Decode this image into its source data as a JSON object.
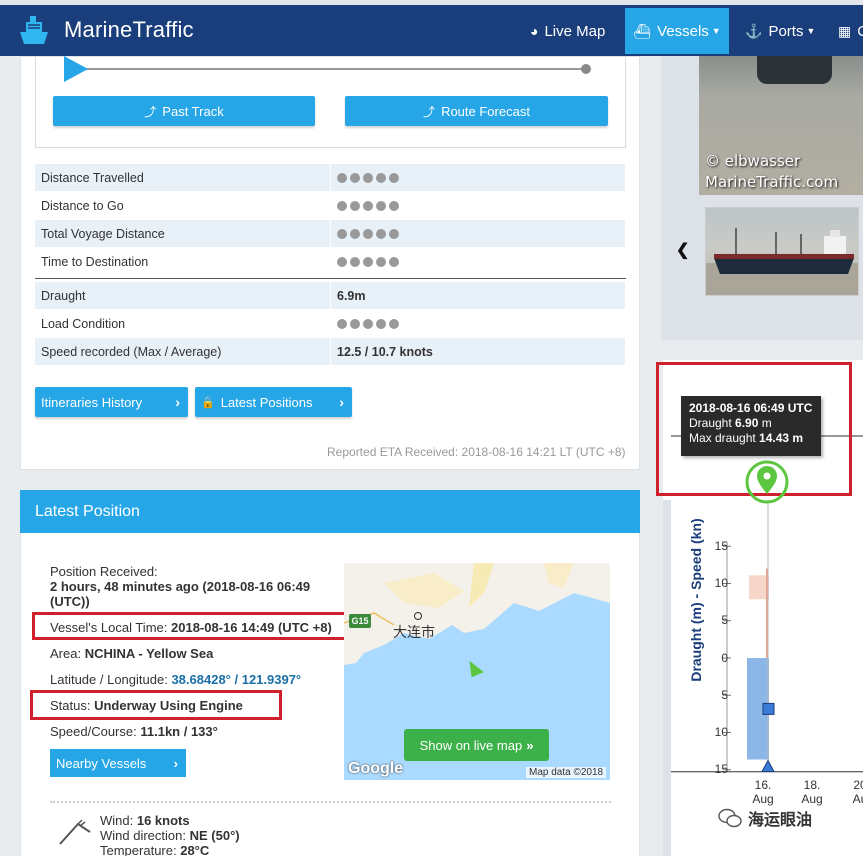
{
  "header": {
    "brand": "MarineTraffic",
    "nav": [
      {
        "label": "Live Map",
        "icon": "globe-icon"
      },
      {
        "label": "Vessels",
        "icon": "ship-icon",
        "active": true
      },
      {
        "label": "Ports",
        "icon": "anchor-icon"
      },
      {
        "label": "C",
        "icon": "grid-icon"
      }
    ]
  },
  "voyage": {
    "past_track": "Past Track",
    "route_forecast": "Route Forecast",
    "rows": [
      {
        "label": "Distance Travelled",
        "value": "",
        "hidden": true
      },
      {
        "label": "Distance to Go",
        "value": "",
        "hidden": true
      },
      {
        "label": "Total Voyage Distance",
        "value": "",
        "hidden": true
      },
      {
        "label": "Time to Destination",
        "value": "",
        "hidden": true
      },
      {
        "label": "Draught",
        "value": "6.9m",
        "hidden": false
      },
      {
        "label": "Load Condition",
        "value": "",
        "hidden": true
      },
      {
        "label": "Speed recorded (Max / Average)",
        "value": "12.5 / 10.7 knots",
        "hidden": false
      }
    ],
    "itineraries_history": "Itineraries History",
    "latest_positions": "Latest Positions",
    "eta_note": "Reported ETA Received: 2018-08-16 14:21 LT (UTC +8)"
  },
  "latest_position": {
    "title": "Latest Position",
    "position_received_label": "Position Received:",
    "position_received_value": "2 hours, 48 minutes ago (2018-08-16 06:49",
    "position_received_value2": "(UTC))",
    "local_time_label": "Vessel's Local Time:",
    "local_time_value": "2018-08-16 14:49 (UTC +8)",
    "area_label": "Area:",
    "area_value": "NCHINA - Yellow Sea",
    "latlon_label": "Latitude / Longitude:",
    "latlon_value": "38.68428° / 121.9397°",
    "status_label": "Status:",
    "status_value": "Underway Using Engine",
    "speed_label": "Speed/Course:",
    "speed_value": "11.1kn / 133°",
    "nearby_vessels": "Nearby Vessels",
    "map": {
      "city": "大连市",
      "road_badge": "G15",
      "show_on_live_map": "Show on live map",
      "google": "Google",
      "map_data": "Map data ©2018"
    },
    "weather": {
      "wind_label": "Wind:",
      "wind_value": "16  knots",
      "wind_dir_label": "Wind direction:",
      "wind_dir_value": "NE (50°)",
      "temp_label": "Temperature:",
      "temp_value": "28°C"
    }
  },
  "photo": {
    "credit_line1": "© elbwasser",
    "credit_line2": "MarineTraffic.com"
  },
  "chart_data": {
    "type": "bar",
    "ylabel": "Draught (m) - Speed (kn)",
    "y_ticks_upper": [
      "15",
      "10",
      "5",
      "0"
    ],
    "y_ticks_lower": [
      "5",
      "10",
      "15"
    ],
    "x_ticks": [
      {
        "line1": "16.",
        "line2": "Aug"
      },
      {
        "line1": "18.",
        "line2": "Aug"
      },
      {
        "line1": "20",
        "line2": "Au"
      }
    ],
    "tooltip": {
      "time": "2018-08-16 06:49 UTC",
      "draught_label": "Draught",
      "draught_value": "6.90",
      "draught_unit": "m",
      "max_label": "Max draught",
      "max_value": "14.43 m"
    },
    "draught_m": 6.9,
    "max_draught_m": 14.43,
    "speed_kn": 11.1
  },
  "watermark": "海运眼油"
}
